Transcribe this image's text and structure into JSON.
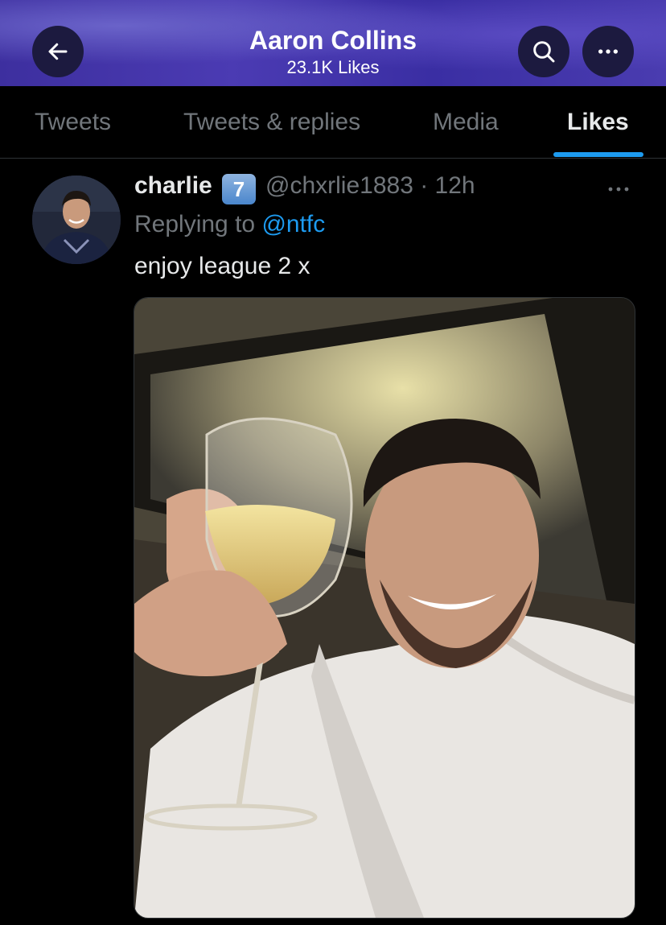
{
  "header": {
    "title": "Aaron Collins",
    "subtitle": "23.1K Likes",
    "back_icon": "arrow-left-icon",
    "search_icon": "search-icon",
    "more_icon": "more-horizontal-icon"
  },
  "tabs": [
    {
      "label": "Tweets",
      "active": false
    },
    {
      "label": "Tweets & replies",
      "active": false
    },
    {
      "label": "Media",
      "active": false
    },
    {
      "label": "Likes",
      "active": true
    }
  ],
  "tweet": {
    "author_name": "charlie",
    "badge": "7",
    "handle_time": "@chxrlie1883 · 12h",
    "replying_prefix": "Replying to ",
    "replying_to": "@ntfc",
    "text": "enjoy league 2 x",
    "more_icon": "more-horizontal-icon"
  },
  "colors": {
    "accent": "#1d9bf0",
    "background": "#000000",
    "header": "#4b3bb3",
    "muted_text": "#71767b"
  }
}
